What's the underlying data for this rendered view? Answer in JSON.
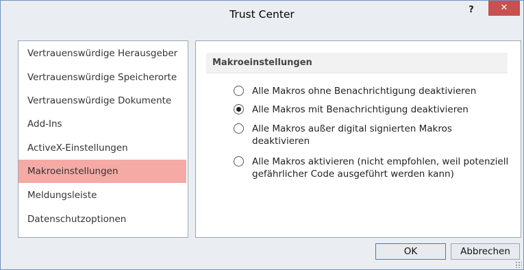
{
  "window": {
    "title": "Trust Center",
    "help_label": "?",
    "close_label": "✕"
  },
  "sidebar": {
    "items": [
      {
        "label": "Vertrauenswürdige Herausgeber"
      },
      {
        "label": "Vertrauenswürdige Speicherorte"
      },
      {
        "label": "Vertrauenswürdige Dokumente"
      },
      {
        "label": "Add-Ins"
      },
      {
        "label": "ActiveX-Einstellungen"
      },
      {
        "label": "Makroeinstellungen",
        "selected": true
      },
      {
        "label": "Meldungsleiste"
      },
      {
        "label": "Datenschutzoptionen"
      }
    ]
  },
  "main": {
    "section_title": "Makroeinstellungen",
    "options": [
      {
        "label": "Alle Makros ohne Benachrichtigung deaktivieren",
        "checked": false
      },
      {
        "label": "Alle Makros mit Benachrichtigung deaktivieren",
        "checked": true
      },
      {
        "label": "Alle Makros außer digital signierten Makros deaktivieren",
        "checked": false
      },
      {
        "label": "Alle Makros aktivieren (nicht empfohlen, weil potenziell gefährlicher Code ausgeführt werden kann)",
        "checked": false
      }
    ]
  },
  "buttons": {
    "ok_label": "OK",
    "cancel_label": "Abbrechen"
  },
  "colors": {
    "accent_selected": "#f5aaa6",
    "close_button": "#c75050",
    "window_bg": "#eaeef2"
  }
}
